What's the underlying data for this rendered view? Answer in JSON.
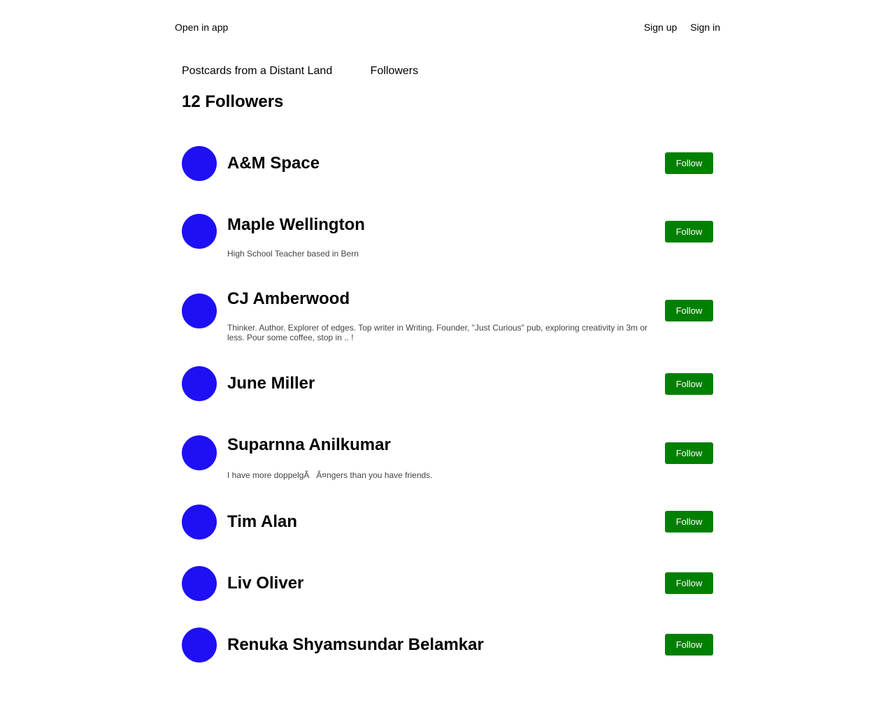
{
  "header": {
    "open_in_app": "Open in app",
    "sign_up": "Sign up",
    "sign_in": "Sign in"
  },
  "breadcrumb": {
    "publication": "Postcards from a Distant Land",
    "section": "Followers"
  },
  "page_title": "12 Followers",
  "colors": {
    "avatar": "#1e0ff5",
    "follow_button": "#008000"
  },
  "followers": [
    {
      "name": "A&M Space",
      "bio": "",
      "button": "Follow"
    },
    {
      "name": "Maple Wellington",
      "bio": "High School Teacher based in Bern",
      "button": "Follow"
    },
    {
      "name": "CJ Amberwood",
      "bio": "Thinker. Author. Explorer of edges. Top writer in Writing. Founder, \"Just Curious\" pub, exploring creativity in 3m or less. Pour some coffee, stop in .. !",
      "button": "Follow"
    },
    {
      "name": "June Miller",
      "bio": "",
      "button": "Follow"
    },
    {
      "name": "Suparnna Anilkumar",
      "bio": "I have more doppelgÃ   Â¤ngers than you have friends.",
      "button": "Follow"
    },
    {
      "name": "Tim Alan",
      "bio": "",
      "button": "Follow"
    },
    {
      "name": "Liv Oliver",
      "bio": "",
      "button": "Follow"
    },
    {
      "name": "Renuka Shyamsundar Belamkar",
      "bio": "",
      "button": "Follow"
    }
  ]
}
